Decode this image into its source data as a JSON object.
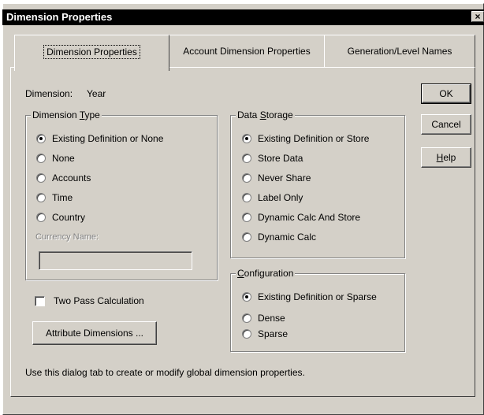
{
  "window": {
    "title": "Dimension Properties",
    "close_glyph": "×"
  },
  "tabs": [
    {
      "label": "Dimension Properties",
      "active": true
    },
    {
      "label": "Account Dimension Properties",
      "active": false
    },
    {
      "label": "Generation/Level Names",
      "active": false
    }
  ],
  "dimension": {
    "label": "Dimension:",
    "value": "Year"
  },
  "dimension_type": {
    "label_pre": "Dimension ",
    "label_accel": "T",
    "label_post": "ype",
    "options": [
      {
        "label": "Existing Definition or None",
        "checked": true
      },
      {
        "label": "None",
        "checked": false
      },
      {
        "label": "Accounts",
        "checked": false
      },
      {
        "label": "Time",
        "checked": false
      },
      {
        "label": "Country",
        "checked": false
      }
    ],
    "currency_label": "Currency Name:",
    "currency_value": ""
  },
  "data_storage": {
    "label_pre": "Data ",
    "label_accel": "S",
    "label_post": "torage",
    "options": [
      {
        "label": "Existing Definition or Store",
        "checked": true
      },
      {
        "label": "Store Data",
        "checked": false
      },
      {
        "label": "Never Share",
        "checked": false
      },
      {
        "label": "Label Only",
        "checked": false
      },
      {
        "label": "Dynamic Calc And Store",
        "checked": false
      },
      {
        "label": "Dynamic Calc",
        "checked": false
      }
    ]
  },
  "configuration": {
    "label_pre": "",
    "label_accel": "C",
    "label_post": "onfiguration",
    "options": [
      {
        "label": "Existing Definition or Sparse",
        "checked": true
      },
      {
        "label": "Dense",
        "checked": false
      },
      {
        "label": "Sparse",
        "checked": false
      }
    ]
  },
  "two_pass": {
    "label": "Two Pass Calculation",
    "checked": false
  },
  "buttons": {
    "attribute": "Attribute Dimensions ...",
    "ok": "OK",
    "cancel": "Cancel",
    "help_accel": "H",
    "help_rest": "elp"
  },
  "hint": "Use this dialog tab to create or modify global dimension properties."
}
